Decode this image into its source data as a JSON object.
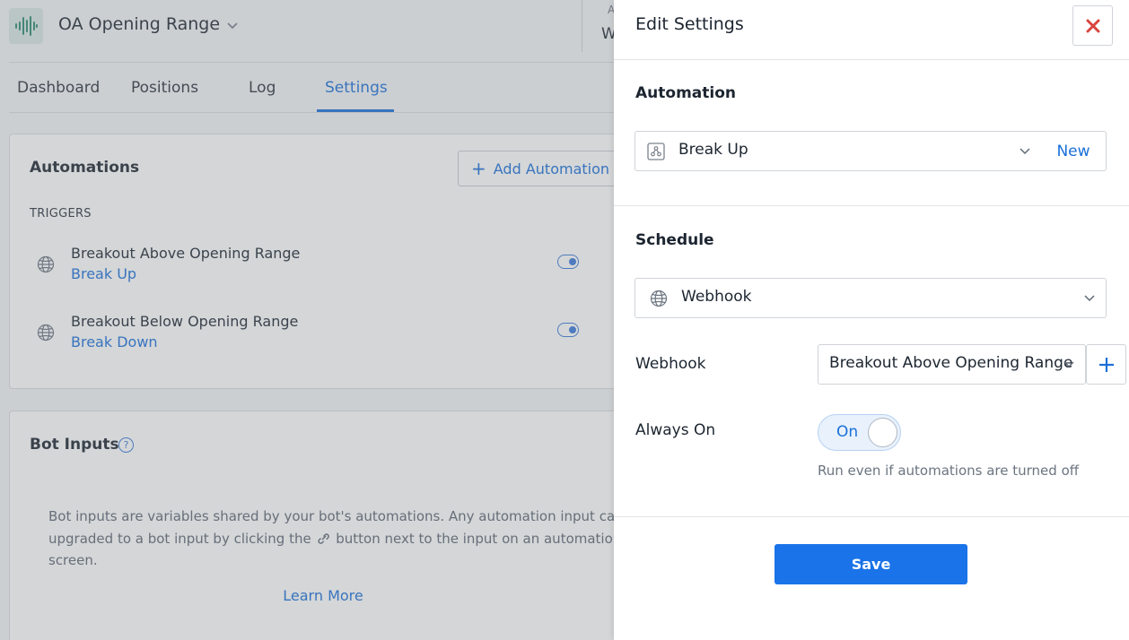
{
  "header": {
    "bot_name": "OA Opening Range",
    "peek_label": "A",
    "peek_value": "W"
  },
  "tabs": [
    {
      "label": "Dashboard",
      "active": false
    },
    {
      "label": "Positions",
      "active": false
    },
    {
      "label": "Log",
      "active": false
    },
    {
      "label": "Settings",
      "active": true
    }
  ],
  "automations": {
    "title": "Automations",
    "add_label": "Add Automation",
    "triggers_label": "TRIGGERS",
    "triggers": [
      {
        "name": "Breakout Above Opening Range",
        "automation": "Break Up",
        "enabled": true
      },
      {
        "name": "Breakout Below Opening Range",
        "automation": "Break Down",
        "enabled": true
      }
    ]
  },
  "bot_inputs": {
    "title": "Bot Inputs",
    "description_1": "Bot inputs are variables shared by your bot's automations. Any automation input can be",
    "description_2": "upgraded to a bot input by clicking the",
    "description_3": "button next to the input on an automation's",
    "description_4": "screen.",
    "learn_more": "Learn More"
  },
  "drawer": {
    "title": "Edit Settings",
    "automation_section": "Automation",
    "automation_value": "Break Up",
    "new_label": "New",
    "schedule_section": "Schedule",
    "schedule_value": "Webhook",
    "webhook_label": "Webhook",
    "webhook_value": "Breakout Above Opening Range",
    "always_on_label": "Always On",
    "always_on_state": "On",
    "always_on_hint": "Run even if automations are turned off",
    "save_label": "Save"
  },
  "colors": {
    "accent": "#1a73e8",
    "close": "#d9443f",
    "logo_bg": "#d8e8e4",
    "logo_fg": "#2e8a73"
  }
}
